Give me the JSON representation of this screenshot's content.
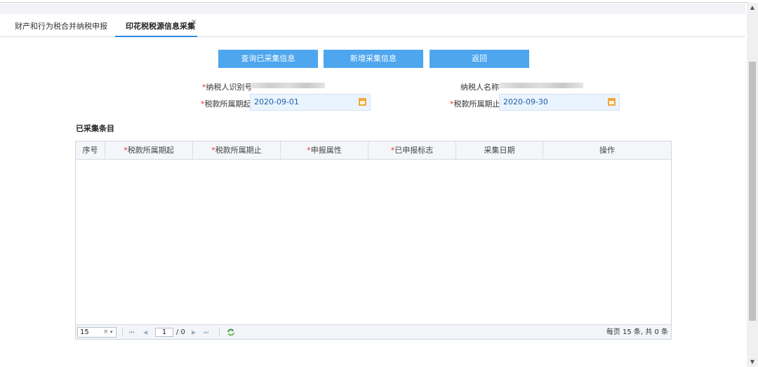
{
  "tabs": [
    {
      "label": "财产和行为税合并纳税申报"
    },
    {
      "label": "印花税税源信息采集",
      "close": "×"
    }
  ],
  "buttons": {
    "query": "查询已采集信息",
    "add": "新增采集信息",
    "back": "返回"
  },
  "form": {
    "required_mark": "*",
    "taxpayer_id_label": "纳税人识别号",
    "taxpayer_name_label": "纳税人名称",
    "period_start_label": "税款所属期起",
    "period_start_value": "2020-09-01",
    "period_end_label": "税款所属期止",
    "period_end_value": "2020-09-30"
  },
  "section_title": "已采集条目",
  "table": {
    "columns": [
      {
        "label": "序号",
        "required": false
      },
      {
        "label": "税款所属期起",
        "required": true
      },
      {
        "label": "税款所属期止",
        "required": true
      },
      {
        "label": "申报属性",
        "required": true
      },
      {
        "label": "已申报标志",
        "required": true
      },
      {
        "label": "采集日期",
        "required": false
      },
      {
        "label": "操作",
        "required": false
      }
    ],
    "rows": []
  },
  "pagination": {
    "page_size": "15",
    "clear": "×",
    "dropdown": "▾",
    "first": "⏮",
    "prev": "◀",
    "next": "▶",
    "last": "⏭",
    "current_page": "1",
    "total_pages": "/ 0",
    "info": "每页 15 条, 共 0 条"
  },
  "scroll": {
    "up": "▲",
    "down": "▼"
  },
  "colors": {
    "accent": "#4ea6ef",
    "tab_underline": "#2f8be6",
    "required": "#e2342f",
    "date_bg": "#eaf4ff",
    "calendar": "#f0a63a"
  }
}
